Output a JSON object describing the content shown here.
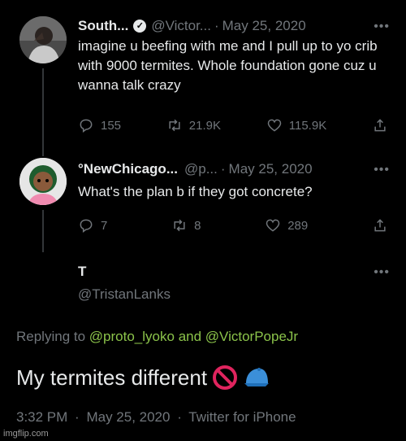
{
  "tweet1": {
    "name": "South...",
    "handle": "@Victor...",
    "sep": "·",
    "date": "May 25, 2020",
    "more": "•••",
    "text": "imagine u beefing with me and I pull up to yo crib with 9000 termites. Whole foundation gone cuz u wanna talk crazy",
    "replies": "155",
    "retweets": "21.9K",
    "likes": "115.9K"
  },
  "tweet2": {
    "name": "°NewChicago...",
    "handle": "@p...",
    "sep": "·",
    "date": "May 25, 2020",
    "more": "•••",
    "text": "What's the plan b if they got concrete?",
    "replies": "7",
    "retweets": "8",
    "likes": "289"
  },
  "main": {
    "name": "T",
    "handle": "@TristanLanks",
    "more": "•••",
    "replying_prefix": "Replying to",
    "replying_user1": "@proto_lyoko",
    "replying_and": "and",
    "replying_user2": "@VictorPopeJr",
    "text": "My termites different",
    "time": "3:32 PM",
    "sep1": "·",
    "date": "May 25, 2020",
    "sep2": "·",
    "source": "Twitter for iPhone"
  },
  "watermark": "imgflip.com",
  "colors": {
    "background": "#000000",
    "text": "#e7e9ea",
    "muted": "#71767b",
    "link": "#8bc34a"
  }
}
